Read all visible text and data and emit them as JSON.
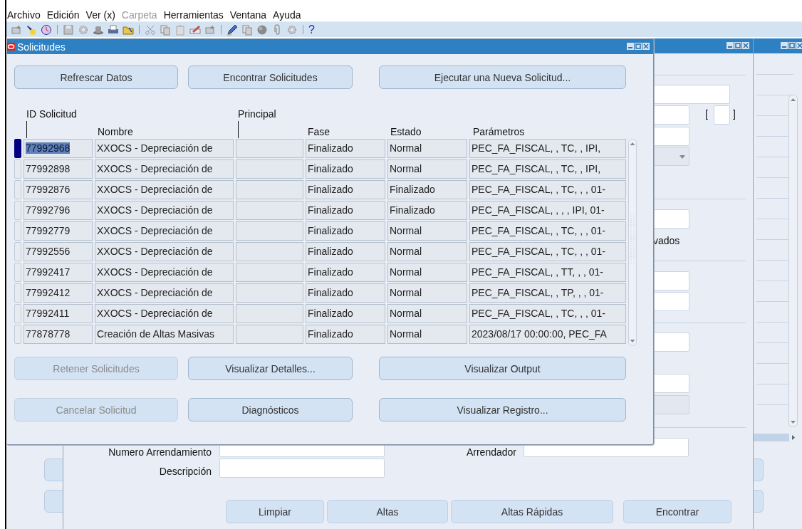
{
  "menu": [
    {
      "label": "Archivo",
      "disabled": false
    },
    {
      "label": "Edición",
      "disabled": false
    },
    {
      "label": "Ver (x)",
      "disabled": false
    },
    {
      "label": "Carpeta",
      "disabled": true
    },
    {
      "label": "Herramientas",
      "disabled": false
    },
    {
      "label": "Ventana",
      "disabled": false
    },
    {
      "label": "Ayuda",
      "disabled": false
    }
  ],
  "toolbar": {
    "help": "?"
  },
  "dialog": {
    "title": "Solicitudes",
    "top_buttons": [
      {
        "label": "Refrescar Datos",
        "disabled": false
      },
      {
        "label": "Encontrar Solicitudes",
        "disabled": false
      },
      {
        "label": "Ejecutar una Nueva Solicitud...",
        "disabled": false
      }
    ],
    "headers": {
      "id": "ID Solicitud",
      "principal": "Principal",
      "nombre": "Nombre",
      "fase": "Fase",
      "estado": "Estado",
      "parametros": "Parámetros"
    },
    "rows": [
      {
        "id": "77992968",
        "nombre": "XXOCS - Depreciación de",
        "fase": "Finalizado",
        "estado": "Normal",
        "parametros": "PEC_FA_FISCAL, , TC, , IPI,",
        "selected": true
      },
      {
        "id": "77992898",
        "nombre": "XXOCS - Depreciación de",
        "fase": "Finalizado",
        "estado": "Normal",
        "parametros": "PEC_FA_FISCAL, , TC, , IPI,",
        "selected": false
      },
      {
        "id": "77992876",
        "nombre": "XXOCS - Depreciación de",
        "fase": "Finalizado",
        "estado": "Finalizado",
        "parametros": "PEC_FA_FISCAL, , TC, , , 01-",
        "selected": false
      },
      {
        "id": "77992796",
        "nombre": "XXOCS - Depreciación de",
        "fase": "Finalizado",
        "estado": "Finalizado",
        "parametros": "PEC_FA_FISCAL, , , , IPI, 01-",
        "selected": false
      },
      {
        "id": "77992779",
        "nombre": "XXOCS - Depreciación de",
        "fase": "Finalizado",
        "estado": "Normal",
        "parametros": "PEC_FA_FISCAL, , TC, , , 01-",
        "selected": false
      },
      {
        "id": "77992556",
        "nombre": "XXOCS - Depreciación de",
        "fase": "Finalizado",
        "estado": "Normal",
        "parametros": "PEC_FA_FISCAL, , TC, , , 01-",
        "selected": false
      },
      {
        "id": "77992417",
        "nombre": "XXOCS - Depreciación de",
        "fase": "Finalizado",
        "estado": "Normal",
        "parametros": "PEC_FA_FISCAL, , TT, , , 01-",
        "selected": false
      },
      {
        "id": "77992412",
        "nombre": "XXOCS - Depreciación de",
        "fase": "Finalizado",
        "estado": "Normal",
        "parametros": "PEC_FA_FISCAL, , TP, , , 01-",
        "selected": false
      },
      {
        "id": "77992411",
        "nombre": "XXOCS - Depreciación de",
        "fase": "Finalizado",
        "estado": "Normal",
        "parametros": "PEC_FA_FISCAL, , TC, , , 01-",
        "selected": false
      },
      {
        "id": "77878778",
        "nombre": "Creación de Altas Masivas",
        "fase": "Finalizado",
        "estado": "Normal",
        "parametros": "2023/08/17 00:00:00, PEC_FA",
        "selected": false
      }
    ],
    "middle_buttons": [
      {
        "label": "Retener Solicitudes",
        "disabled": true
      },
      {
        "label": "Visualizar Detalles...",
        "disabled": false
      },
      {
        "label": "Visualizar Output",
        "disabled": false
      }
    ],
    "bottom_buttons": [
      {
        "label": "Cancelar Solicitud",
        "disabled": true
      },
      {
        "label": "Diagnósticos",
        "disabled": false
      },
      {
        "label": "Visualizar Registro...",
        "disabled": false
      }
    ]
  },
  "main_form": {
    "bracket_open": "[",
    "bracket_close": "]",
    "partial_label": "vados",
    "fields": [
      {
        "label": "Numero Arrendamiento"
      },
      {
        "label": "Descripción"
      },
      {
        "label": "Arrendador"
      }
    ],
    "buttons": [
      "Limpiar",
      "Altas",
      "Altas Rápidas",
      "Encontrar"
    ]
  }
}
